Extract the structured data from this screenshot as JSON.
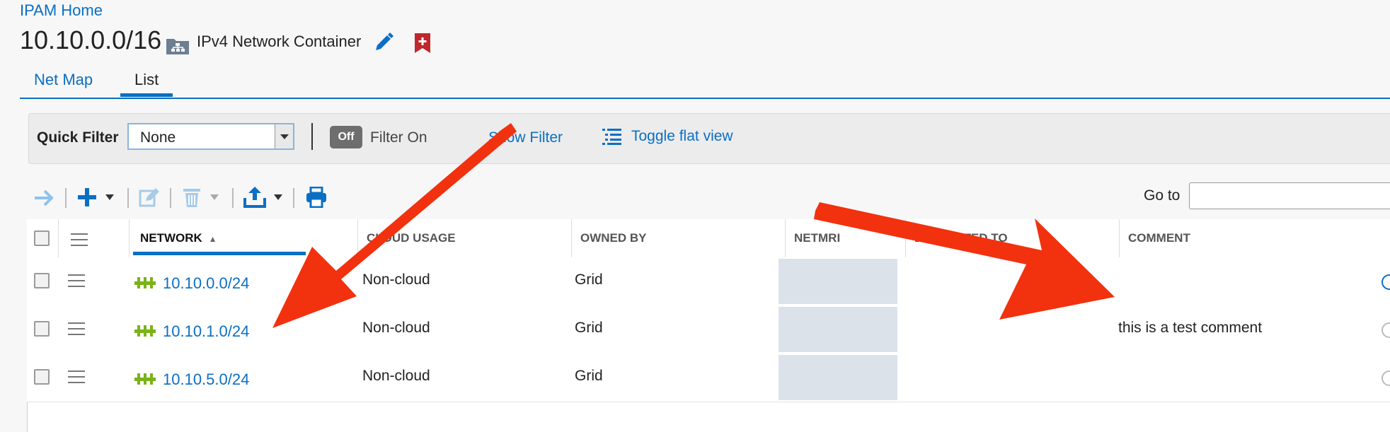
{
  "breadcrumb": "IPAM Home",
  "title": "10.10.0.0/16",
  "container_type": "IPv4 Network Container",
  "tabs": [
    "Net Map",
    "List"
  ],
  "active_tab": "List",
  "filter_bar": {
    "quick_filter_label": "Quick Filter",
    "quick_filter_value": "None",
    "toggle_state": "Off",
    "filter_on_label": "Filter On",
    "show_filter": "Show Filter",
    "toggle_flat_view": "Toggle flat view"
  },
  "toolbar": {
    "goto_label": "Go to",
    "icons": [
      "arrow-right-icon",
      "add-icon",
      "edit-icon",
      "delete-icon",
      "export-icon",
      "print-icon"
    ]
  },
  "table": {
    "columns": [
      "NETWORK",
      "CLOUD USAGE",
      "OWNED BY",
      "NETMRI",
      "DELEGATED TO",
      "COMMENT"
    ],
    "rows": [
      {
        "network": "10.10.0.0/24",
        "cloud_usage": "Non-cloud",
        "owned_by": "Grid",
        "comment": ""
      },
      {
        "network": "10.10.1.0/24",
        "cloud_usage": "Non-cloud",
        "owned_by": "Grid",
        "comment": "this is a test comment"
      },
      {
        "network": "10.10.5.0/24",
        "cloud_usage": "Non-cloud",
        "owned_by": "Grid",
        "comment": ""
      }
    ]
  },
  "colors": {
    "link": "#0a6fc4",
    "annotation_arrow": "#f2310f",
    "netmri_fill": "#dce2ea",
    "network_icon": "#7ab317"
  }
}
